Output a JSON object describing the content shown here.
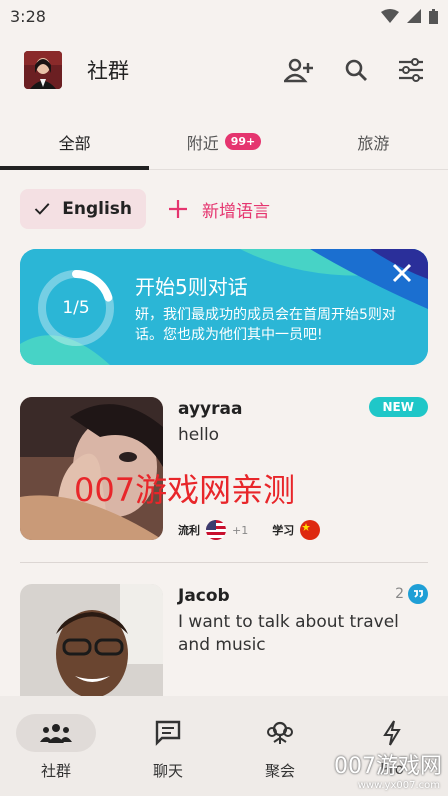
{
  "status_bar": {
    "time": "3:28"
  },
  "header": {
    "title": "社群"
  },
  "tabs": [
    {
      "label": "全部",
      "active": true
    },
    {
      "label": "附近",
      "badge": "99+"
    },
    {
      "label": "旅游"
    }
  ],
  "language_filter": {
    "selected": "English",
    "add_label": "新增语言"
  },
  "promo": {
    "progress_text": "1/5",
    "progress_fraction": 0.2,
    "title": "开始5则对话",
    "body": "妍，我们最成功的成员会在首周开始5则对话。您也成为他们其中一员吧!"
  },
  "members": [
    {
      "name": "ayyraa",
      "message": "hello",
      "badge": "NEW",
      "fluent_label": "流利",
      "fluent_extra": "+1",
      "learning_label": "学习"
    },
    {
      "name": "Jacob",
      "message": "I want to talk about travel and music",
      "reply_count": "2"
    }
  ],
  "watermark": {
    "text": "007游戏网亲测",
    "corner": "007游戏网",
    "url": "www.yx007.com"
  },
  "bottom_nav": [
    {
      "label": "社群",
      "icon": "community-icon",
      "active": true
    },
    {
      "label": "聊天",
      "icon": "chat-icon"
    },
    {
      "label": "聚会",
      "icon": "meetup-icon"
    },
    {
      "label": "Pro",
      "icon": "lightning-icon"
    }
  ],
  "colors": {
    "accent": "#e5356f",
    "teal": "#1fc7c8",
    "promo": "#2bb6d6"
  }
}
